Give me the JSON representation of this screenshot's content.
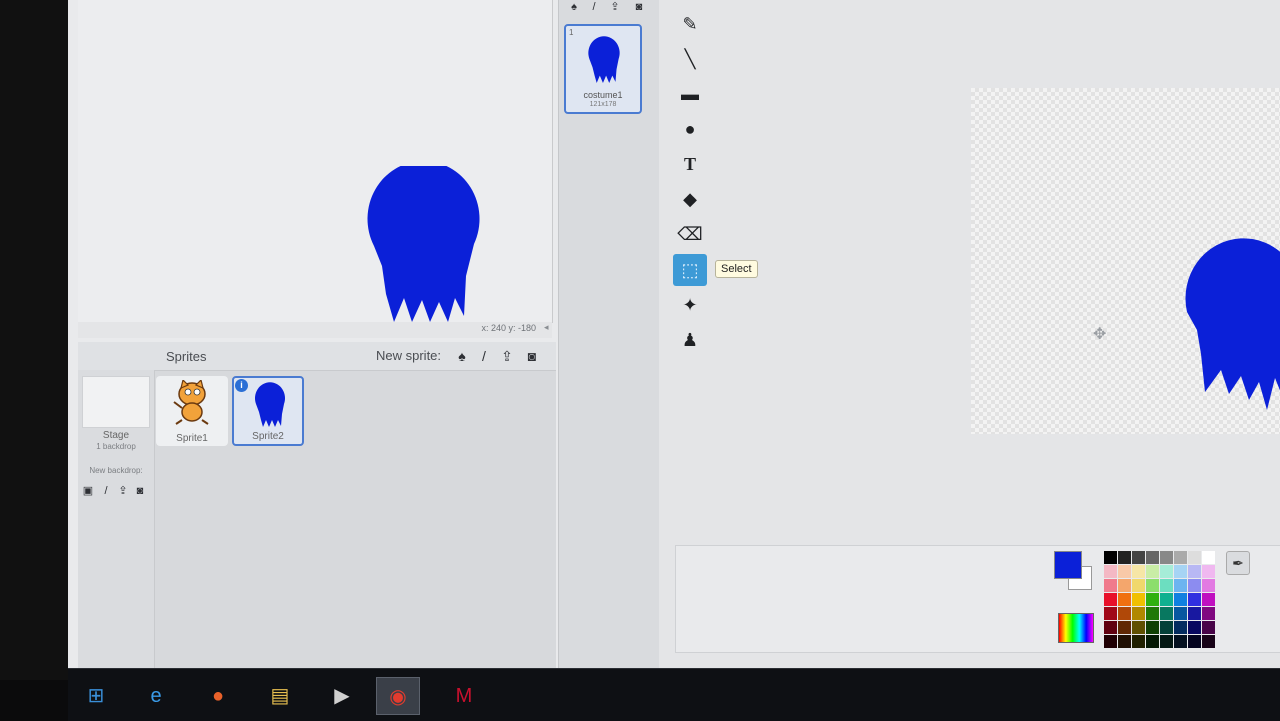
{
  "stage": {
    "coords": "x: 240   y: -180",
    "collapse_icon": "arrow-left-icon"
  },
  "sprites_pane": {
    "title": "Sprites",
    "new_sprite_label": "New sprite:",
    "new_sprite_icons": [
      "choose-from-library-icon",
      "paint-new-icon",
      "upload-icon",
      "camera-icon"
    ],
    "stage_label": "Stage",
    "stage_sub": "1 backdrop",
    "new_backdrop_label": "New backdrop:",
    "sprites": [
      {
        "name": "Sprite1",
        "selected": false
      },
      {
        "name": "Sprite2",
        "selected": true
      }
    ]
  },
  "costumes": {
    "items": [
      {
        "number": "1",
        "name": "costume1",
        "size": "121x178",
        "selected": true
      }
    ]
  },
  "paint_editor": {
    "tools": [
      "brush-icon",
      "line-icon",
      "rectangle-icon",
      "ellipse-icon",
      "text-icon",
      "fill-icon",
      "eraser-icon",
      "select-icon",
      "select-remove-background-icon",
      "stamp-icon"
    ],
    "active_tool": "select",
    "tooltip": "Select",
    "primary_color": "#0b20d8",
    "secondary_color": "#ffffff",
    "palette": [
      "#000000",
      "#222222",
      "#444444",
      "#666666",
      "#888888",
      "#aaaaaa",
      "#dddddd",
      "#ffffff",
      "#f4b8c4",
      "#f8c9a8",
      "#f6e6a6",
      "#c9eda6",
      "#a6edd8",
      "#a6d4f4",
      "#b8b8f4",
      "#f0b8f0",
      "#f07a8c",
      "#f4a66c",
      "#f0d86c",
      "#8cde6c",
      "#6cdec0",
      "#6cb4f0",
      "#8c8cf0",
      "#e27ae2",
      "#e8102a",
      "#f07010",
      "#f0c000",
      "#30b010",
      "#10b090",
      "#1080e0",
      "#3030e0",
      "#c010c0",
      "#a00818",
      "#b04808",
      "#b08800",
      "#207808",
      "#087860",
      "#0858a0",
      "#1818a0",
      "#800880",
      "#600010",
      "#602804",
      "#605000",
      "#104004",
      "#044038",
      "#042c60",
      "#080860",
      "#480448",
      "#200004",
      "#201004",
      "#202000",
      "#041804",
      "#041814",
      "#041020",
      "#040420",
      "#180418"
    ]
  },
  "taskbar": {
    "items": [
      {
        "name": "start-button",
        "icon": "windows-logo-icon",
        "glyph": "⊞",
        "active": false
      },
      {
        "name": "internet-explorer-task",
        "icon": "internet-explorer-icon",
        "glyph": "e",
        "active": false
      },
      {
        "name": "firefox-task",
        "icon": "firefox-icon",
        "glyph": "●",
        "active": false
      },
      {
        "name": "file-explorer-task",
        "icon": "folder-icon",
        "glyph": "▤",
        "active": false
      },
      {
        "name": "media-player-task",
        "icon": "media-player-icon",
        "glyph": "▶",
        "active": false
      },
      {
        "name": "chrome-task",
        "icon": "chrome-icon",
        "glyph": "◉",
        "active": true
      },
      {
        "name": "mcafee-task",
        "icon": "mcafee-icon",
        "glyph": "M",
        "active": false
      }
    ]
  }
}
